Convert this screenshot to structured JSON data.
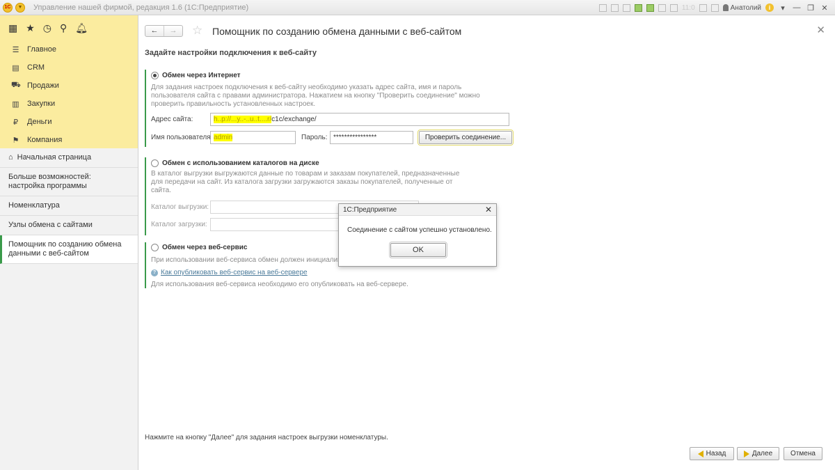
{
  "titlebar": {
    "app_title": "Управление нашей фирмой, редакция 1.6  (1С:Предприятие)",
    "clock_dim": "11:0",
    "user": "Анатолий",
    "logo_text": "1С"
  },
  "sidebar": {
    "menu": [
      {
        "label": "Главное",
        "icon": "list-icon"
      },
      {
        "label": "CRM",
        "icon": "crm-icon"
      },
      {
        "label": "Продажи",
        "icon": "basket-icon"
      },
      {
        "label": "Закупки",
        "icon": "purchases-icon"
      },
      {
        "label": "Деньги",
        "icon": "money-icon"
      },
      {
        "label": "Компания",
        "icon": "flag-icon"
      }
    ],
    "open_windows": {
      "home": "Начальная страница",
      "more": "Больше возможностей: настройка программы",
      "nomenclature": "Номенклатура",
      "nodes": "Узлы обмена с сайтами",
      "wizard": "Помощник по созданию обмена данными с веб-сайтом"
    }
  },
  "main": {
    "title": "Помощник по созданию обмена данными с веб-сайтом",
    "section_title": "Задайте настройки подключения к веб-сайту",
    "internet": {
      "label": "Обмен через Интернет",
      "desc": [
        "Для задания настроек подключения к веб-сайту необходимо указать адрес сайта, имя и пароль",
        "пользователя сайта с правами администратора. Нажатием на кнопку \"Проверить соединение\" можно",
        "проверить правильность установленных настроек."
      ],
      "site_label": "Адрес сайта:",
      "site_value_hidden": "h..p://...y..-..u..t....r/",
      "site_value_visible": "c1c/exchange/",
      "user_label": "Имя пользователя:",
      "user_value": "admin",
      "password_label": "Пароль:",
      "password_value": "****************",
      "check_button": "Проверить соединение..."
    },
    "disk": {
      "label": "Обмен с использованием каталогов на диске",
      "desc": [
        "В каталог выгрузки выгружаются данные по товарам и заказам покупателей, предназначенные",
        "для передачи на сайт. Из каталога загрузки загружаются заказы покупателей, полученные от",
        "сайта."
      ],
      "export_label": "Каталог выгрузки:",
      "import_label": "Каталог загрузки:"
    },
    "webservice": {
      "label": "Обмен через веб-сервис",
      "desc": "При использовании веб-сервиса обмен должен инициализир",
      "link": "Как опубликовать веб-сервис на веб-сервере",
      "note": "Для использования веб-сервиса необходимо его опубликовать на веб-сервере."
    },
    "footer_note": "Нажмите на кнопку \"Далее\" для задания настроек выгрузки номенклатуры.",
    "buttons": {
      "back": "Назад",
      "next": "Далее",
      "cancel": "Отмена"
    }
  },
  "dialog": {
    "title": "1С:Предприятие",
    "message": "Соединение с сайтом успешно установлено.",
    "ok": "OK"
  },
  "colors": {
    "sidebar_top": "#fbec9f",
    "accent_green": "#3a9a4a",
    "highlight": "#ffff00"
  }
}
